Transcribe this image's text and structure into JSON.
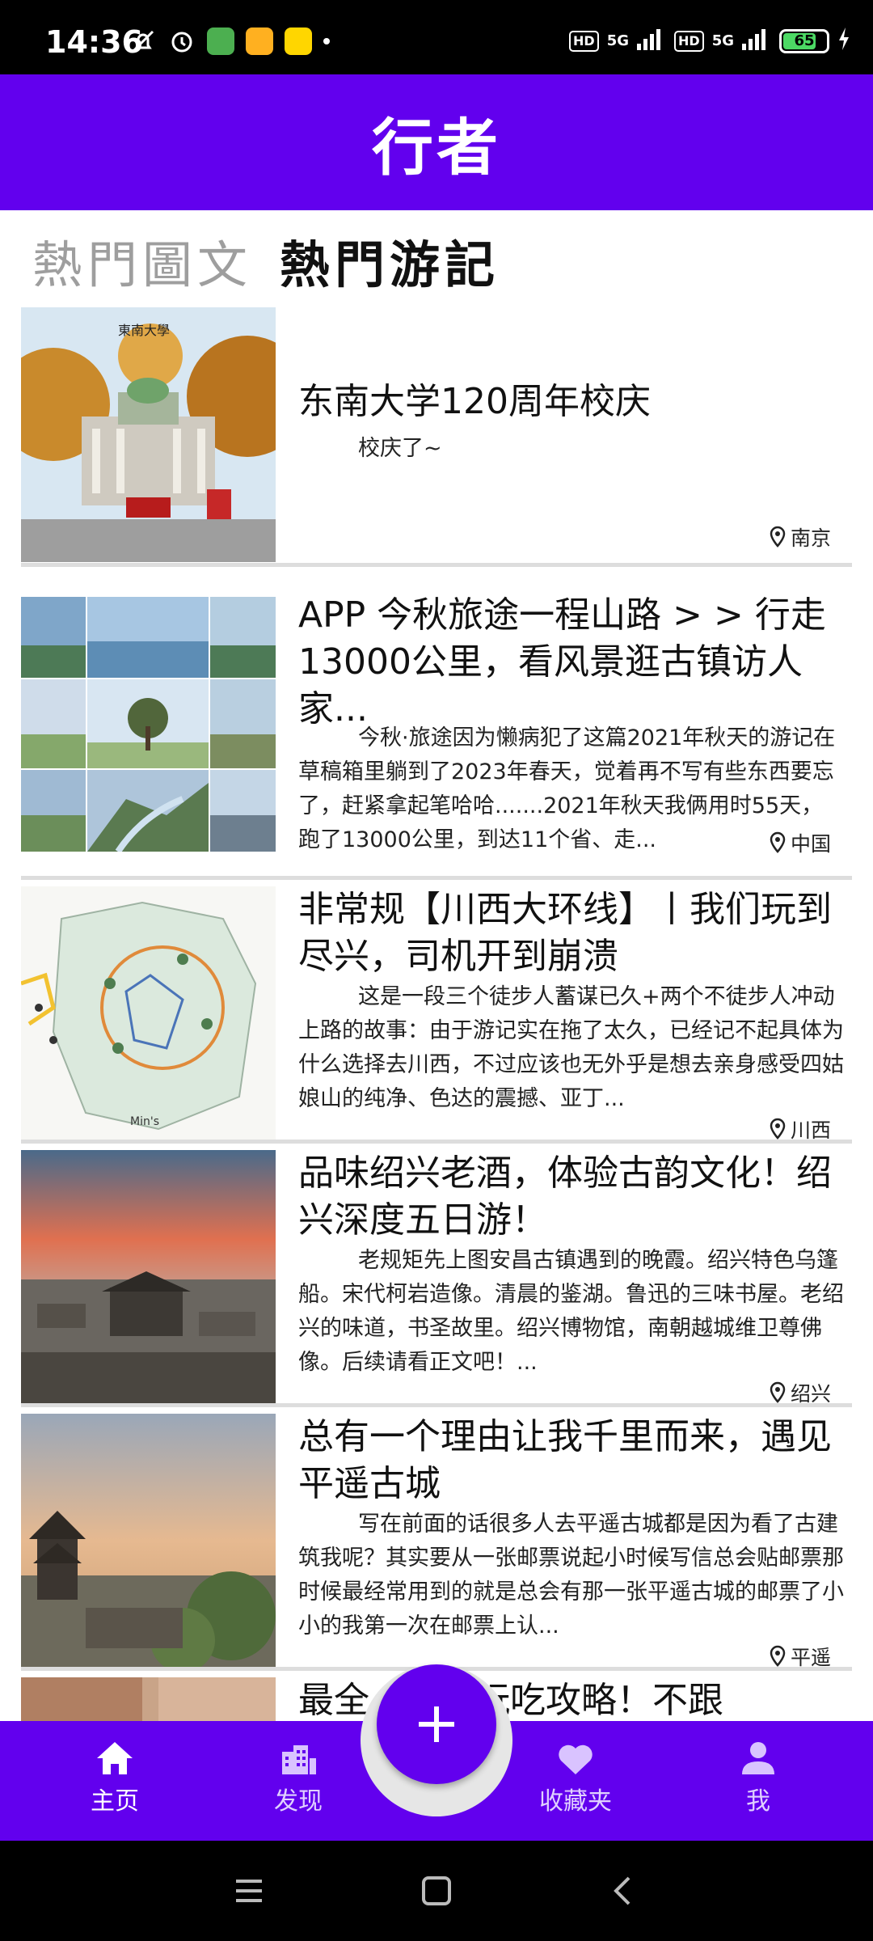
{
  "status_bar": {
    "time": "14:36",
    "battery": "65",
    "network_1": "5G",
    "network_2": "5G",
    "hd": "HD"
  },
  "app_bar": {
    "title": "行者"
  },
  "tabs": [
    {
      "label": "熱門圖文",
      "active": false
    },
    {
      "label": "熱門游記",
      "active": true
    }
  ],
  "cards": [
    {
      "title": "东南大学120周年校庆",
      "excerpt": "校庆了~",
      "location": "南京",
      "image_icon": "campus-photo"
    },
    {
      "title": " APP 今秋旅途一程山路 > > 行走13000公里，看风景逛古镇访人家...",
      "excerpt": "今秋·旅途因为懒病犯了这篇2021年秋天的游记在草稿箱里躺到了2023年春天，觉着再不写有些东西要忘了，赶紧拿起笔哈哈.......2021年秋天我俩用时55天，跑了13000公里，到达11个省、走...",
      "location": "中国",
      "image_icon": "landscape-collage"
    },
    {
      "title": " 非常规【川西大环线】丨我们玩到尽兴，司机开到崩溃",
      "excerpt": "这是一段三个徒步人蓄谋已久+两个不徒步人冲动上路的故事：由于游记实在拖了太久，已经记不起具体为什么选择去川西，不过应该也无外乎是想去亲身感受四姑娘山的纯净、色达的震撼、亚丁...",
      "location": "川西",
      "image_icon": "route-map"
    },
    {
      "title": " 品味绍兴老酒，体验古韵文化！绍兴深度五日游！",
      "excerpt": "老规矩先上图安昌古镇遇到的晚霞。绍兴特色乌篷船。宋代柯岩造像。清晨的鉴湖。鲁迅的三味书屋。老绍兴的味道，书圣故里。绍兴博物馆，南朝越城维卫尊佛像。后续请看正文吧！...",
      "location": "绍兴",
      "image_icon": "sunset-town"
    },
    {
      "title": " 总有一个理由让我千里而来，遇见平遥古城",
      "excerpt": "写在前面的话很多人去平遥古城都是因为看了古建筑我呢？其实要从一张邮票说起小时候写信总会贴邮票那时候最经常用到的就是总会有那一张平遥古城的邮票了小小的我第一次在邮票上认...",
      "location": "平遥",
      "image_icon": "ancient-city"
    },
    {
      "title": " 最全【...】玩吃攻略！不跟",
      "excerpt": "",
      "location": "",
      "image_icon": "food-photo"
    }
  ],
  "bottom_nav": [
    {
      "label": "主页",
      "icon": "home-icon",
      "active": true
    },
    {
      "label": "发现",
      "icon": "city-icon",
      "active": false
    },
    {
      "label": "收藏夹",
      "icon": "heart-icon",
      "active": false
    },
    {
      "label": "我",
      "icon": "person-icon",
      "active": false
    }
  ],
  "fab": {
    "icon": "plus-icon"
  },
  "colors": {
    "primary": "#6200ee",
    "divider": "#dddddd"
  }
}
